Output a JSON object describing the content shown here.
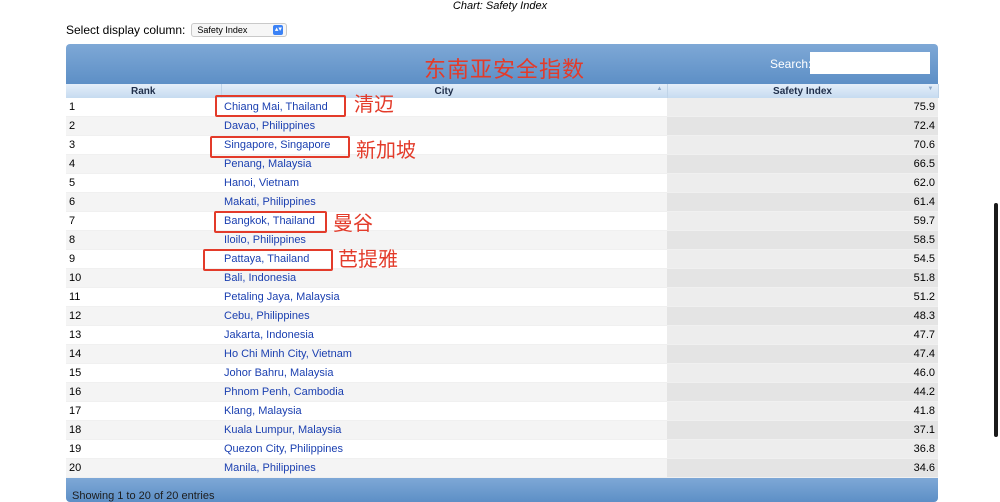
{
  "chart_title": "Chart: Safety Index",
  "selector": {
    "label": "Select display column:",
    "value": "Safety Index"
  },
  "search": {
    "label": "Search:",
    "value": ""
  },
  "columns": {
    "rank": "Rank",
    "city": "City",
    "safety_index": "Safety Index"
  },
  "rows": [
    {
      "rank": "1",
      "city": "Chiang Mai, Thailand",
      "score": "75.9"
    },
    {
      "rank": "2",
      "city": "Davao, Philippines",
      "score": "72.4"
    },
    {
      "rank": "3",
      "city": "Singapore, Singapore",
      "score": "70.6"
    },
    {
      "rank": "4",
      "city": "Penang, Malaysia",
      "score": "66.5"
    },
    {
      "rank": "5",
      "city": "Hanoi, Vietnam",
      "score": "62.0"
    },
    {
      "rank": "6",
      "city": "Makati, Philippines",
      "score": "61.4"
    },
    {
      "rank": "7",
      "city": "Bangkok, Thailand",
      "score": "59.7"
    },
    {
      "rank": "8",
      "city": "Iloilo, Philippines",
      "score": "58.5"
    },
    {
      "rank": "9",
      "city": "Pattaya, Thailand",
      "score": "54.5"
    },
    {
      "rank": "10",
      "city": "Bali, Indonesia",
      "score": "51.8"
    },
    {
      "rank": "11",
      "city": "Petaling Jaya, Malaysia",
      "score": "51.2"
    },
    {
      "rank": "12",
      "city": "Cebu, Philippines",
      "score": "48.3"
    },
    {
      "rank": "13",
      "city": "Jakarta, Indonesia",
      "score": "47.7"
    },
    {
      "rank": "14",
      "city": "Ho Chi Minh City, Vietnam",
      "score": "47.4"
    },
    {
      "rank": "15",
      "city": "Johor Bahru, Malaysia",
      "score": "46.0"
    },
    {
      "rank": "16",
      "city": "Phnom Penh, Cambodia",
      "score": "44.2"
    },
    {
      "rank": "17",
      "city": "Klang, Malaysia",
      "score": "41.8"
    },
    {
      "rank": "18",
      "city": "Kuala Lumpur, Malaysia",
      "score": "37.1"
    },
    {
      "rank": "19",
      "city": "Quezon City, Philippines",
      "score": "36.8"
    },
    {
      "rank": "20",
      "city": "Manila, Philippines",
      "score": "34.6"
    }
  ],
  "footer": {
    "info": "Showing 1 to 20 of 20 entries"
  },
  "annotations": {
    "title": "东南亚安全指数",
    "chiang_mai": "清迈",
    "singapore": "新加坡",
    "bangkok": "曼谷",
    "pattaya": "芭提雅",
    "color": "#e33b2a"
  },
  "colors": {
    "header_blue": "#6c9bcf",
    "link": "#1a3fb0"
  }
}
